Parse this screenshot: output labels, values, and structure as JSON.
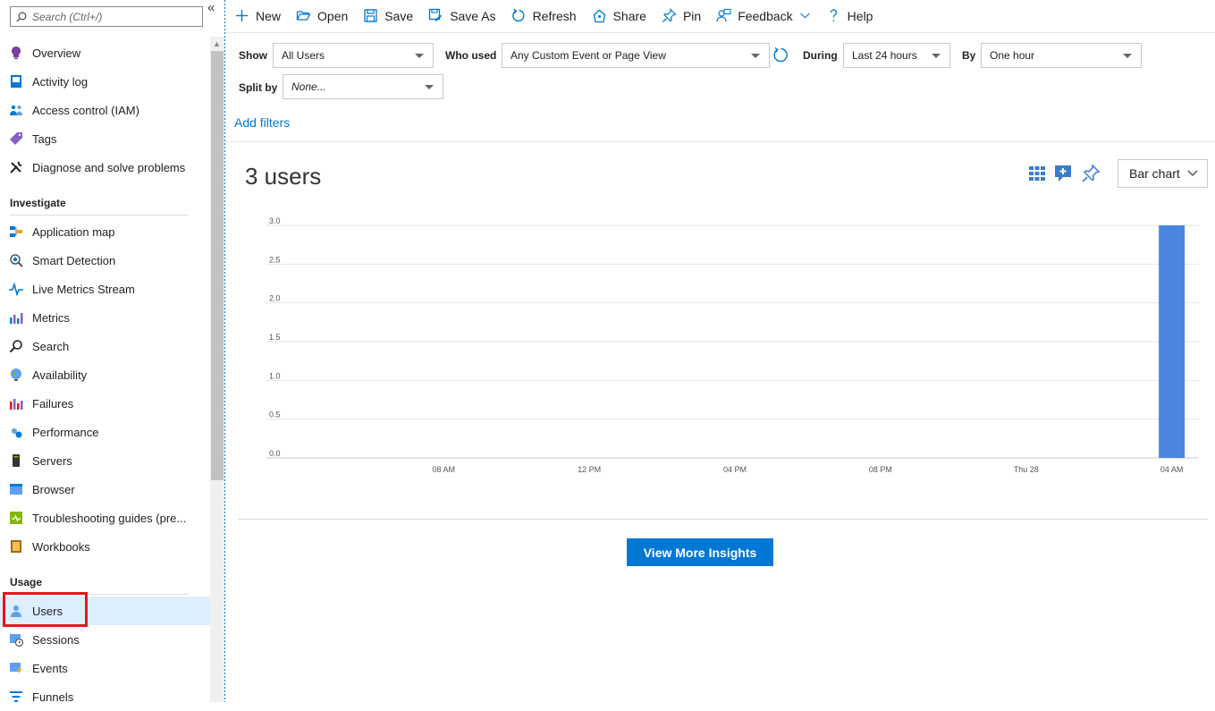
{
  "sidebar": {
    "search_placeholder": "Search (Ctrl+/)",
    "collapse": "«",
    "top_items": [
      {
        "label": "Overview",
        "icon": "overview-icon"
      },
      {
        "label": "Activity log",
        "icon": "activity-log-icon"
      },
      {
        "label": "Access control (IAM)",
        "icon": "iam-icon"
      },
      {
        "label": "Tags",
        "icon": "tag-icon"
      },
      {
        "label": "Diagnose and solve problems",
        "icon": "wrench-icon"
      }
    ],
    "investigate_heading": "Investigate",
    "investigate_items": [
      {
        "label": "Application map",
        "icon": "app-map-icon"
      },
      {
        "label": "Smart Detection",
        "icon": "smart-detection-icon"
      },
      {
        "label": "Live Metrics Stream",
        "icon": "pulse-icon"
      },
      {
        "label": "Metrics",
        "icon": "metrics-icon"
      },
      {
        "label": "Search",
        "icon": "search-icon"
      },
      {
        "label": "Availability",
        "icon": "globe-icon"
      },
      {
        "label": "Failures",
        "icon": "failures-icon"
      },
      {
        "label": "Performance",
        "icon": "performance-icon"
      },
      {
        "label": "Servers",
        "icon": "server-icon"
      },
      {
        "label": "Browser",
        "icon": "browser-icon"
      },
      {
        "label": "Troubleshooting guides (pre...",
        "icon": "troubleshoot-icon"
      },
      {
        "label": "Workbooks",
        "icon": "workbook-icon"
      }
    ],
    "usage_heading": "Usage",
    "usage_items": [
      {
        "label": "Users",
        "icon": "user-icon",
        "selected": true
      },
      {
        "label": "Sessions",
        "icon": "sessions-icon"
      },
      {
        "label": "Events",
        "icon": "events-icon"
      },
      {
        "label": "Funnels",
        "icon": "funnel-icon"
      }
    ]
  },
  "toolbar": {
    "new": "New",
    "open": "Open",
    "save": "Save",
    "save_as": "Save As",
    "refresh": "Refresh",
    "share": "Share",
    "pin": "Pin",
    "feedback": "Feedback",
    "help": "Help"
  },
  "filters": {
    "show_label": "Show",
    "show_value": "All Users",
    "who_used_label": "Who used",
    "who_used_value": "Any Custom Event or Page View",
    "during_label": "During",
    "during_value": "Last 24 hours",
    "by_label": "By",
    "by_value": "One hour",
    "split_by_label": "Split by",
    "split_by_value": "None...",
    "add_filters": "Add filters"
  },
  "summary": {
    "title": "3 users",
    "chart_type_label": "Bar chart",
    "insights_button": "View More Insights"
  },
  "colors": {
    "accent": "#0078d4",
    "bar": "#4a86e0",
    "highlight": "#e3171f"
  },
  "chart_data": {
    "type": "bar",
    "x_tick_labels": [
      "08 AM",
      "12 PM",
      "04 PM",
      "08 PM",
      "Thu 28",
      "04 AM"
    ],
    "y_tick_labels": [
      "0.0",
      "0.5",
      "1.0",
      "1.5",
      "2.0",
      "2.5",
      "3.0"
    ],
    "ylim": [
      0,
      3
    ],
    "bins": 25,
    "values": [
      0,
      0,
      0,
      0,
      0,
      0,
      0,
      0,
      0,
      0,
      0,
      0,
      0,
      0,
      0,
      0,
      0,
      0,
      0,
      0,
      0,
      0,
      0,
      0,
      3
    ],
    "grid": true
  }
}
